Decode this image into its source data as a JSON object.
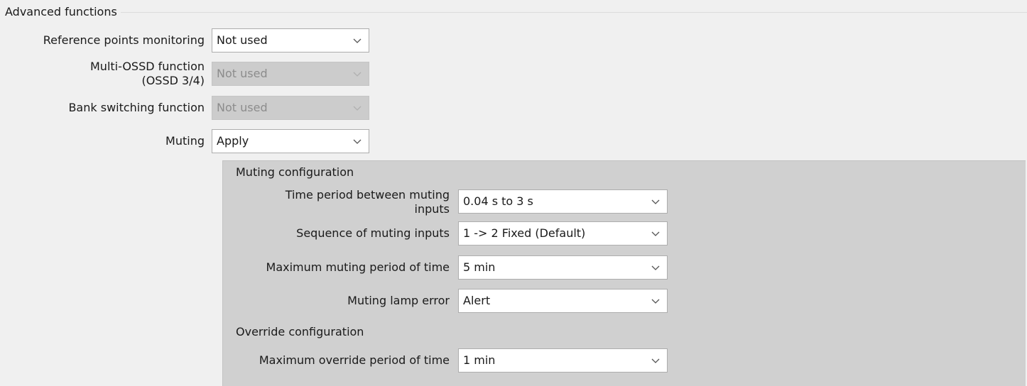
{
  "advanced": {
    "title": "Advanced functions",
    "reference_points": {
      "label": "Reference points monitoring",
      "value": "Not used",
      "enabled": true
    },
    "multi_ossd": {
      "label_line1": "Multi-OSSD function",
      "label_line2": "(OSSD 3/4)",
      "value": "Not used",
      "enabled": false
    },
    "bank_switching": {
      "label": "Bank switching function",
      "value": "Not used",
      "enabled": false
    },
    "muting": {
      "label": "Muting",
      "value": "Apply",
      "enabled": true
    }
  },
  "muting_config": {
    "title": "Muting configuration",
    "time_period": {
      "label_line1": "Time period between muting",
      "label_line2": "inputs",
      "value": "0.04 s to 3 s"
    },
    "sequence": {
      "label": "Sequence of muting inputs",
      "value": "1 -> 2 Fixed (Default)"
    },
    "max_period": {
      "label": "Maximum muting period of time",
      "value": "5 min"
    },
    "lamp_error": {
      "label": "Muting lamp error",
      "value": "Alert"
    }
  },
  "override_config": {
    "title": "Override configuration",
    "max_override": {
      "label": "Maximum override period of time",
      "value": "1 min"
    }
  },
  "icons": {
    "dropdown": "chevron-down-icon"
  },
  "colors": {
    "panel_bg": "#d0d0d0",
    "disabled_field": "#cccccc",
    "disabled_text": "#8c8c8c"
  }
}
